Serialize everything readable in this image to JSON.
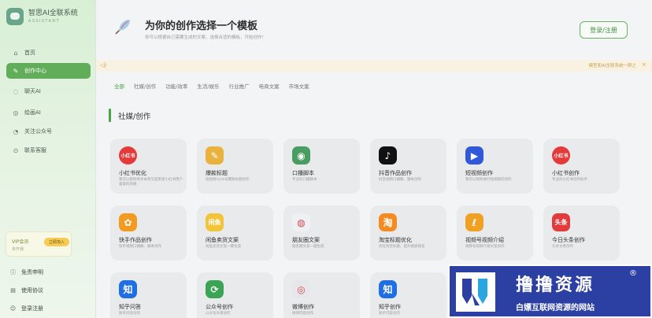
{
  "brand": {
    "name": "智思AI全联系统",
    "sub": "ASSISTANT"
  },
  "nav": [
    {
      "label": "首页",
      "icon": "home-icon",
      "active": false
    },
    {
      "label": "创作中心",
      "icon": "edit-icon",
      "active": true
    },
    {
      "label": "聊天AI",
      "icon": "chat-icon",
      "active": false
    },
    {
      "label": "绘画AI",
      "icon": "paint-icon",
      "active": false
    },
    {
      "label": "关注公众号",
      "icon": "wechat-icon",
      "active": false
    },
    {
      "label": "联系客服",
      "icon": "location-icon",
      "active": false
    }
  ],
  "vip": {
    "title": "VIP会员",
    "sub": "未开通",
    "button": "立即加入"
  },
  "bottom_links": [
    {
      "label": "免责申明",
      "icon": "info-icon"
    },
    {
      "label": "使用协议",
      "icon": "doc-icon"
    },
    {
      "label": "登录注册",
      "icon": "user-icon"
    }
  ],
  "header": {
    "title": "为你的创作选择一个模板",
    "subtitle": "你可以根据自己需要生成的文案，选择合适的模板，开始创作！",
    "login": "登录/注册"
  },
  "notice": {
    "text": "模型和AI全联系统一群之"
  },
  "tabs": [
    "全部",
    "社媒/创作",
    "功能/效率",
    "生活/娱乐",
    "行业推广",
    "电商文案",
    "市场文案"
  ],
  "section_title": "社媒/创作",
  "cards": [
    {
      "title": "小红书优化",
      "desc": "我可以帮你将文本改写成更受小红书用户喜爱的风格",
      "icon": "xiaohongshu-icon",
      "color": "#e53a3a",
      "glyph": "小红书"
    },
    {
      "title": "爆款标题",
      "desc": "短视频/公众号爆款标题创作",
      "icon": "pen-icon",
      "color": "#e8b23c",
      "glyph": "✎"
    },
    {
      "title": "口播脚本",
      "desc": "专业的口播脚本",
      "icon": "voice-icon",
      "color": "#4a9d62",
      "glyph": "◉"
    },
    {
      "title": "抖音作品创作",
      "desc": "抖音视频口播稿、脚本创作",
      "icon": "douyin-icon",
      "color": "#111111",
      "glyph": "♪"
    },
    {
      "title": "短视频创作",
      "desc": "我可以帮你进行短视频的创作",
      "icon": "video-icon",
      "color": "#2f59d9",
      "glyph": "▶"
    },
    {
      "title": "小红书创作",
      "desc": "专业的小红书创作助手",
      "icon": "xiaohongshu-icon",
      "color": "#e53a3a",
      "glyph": "小红书"
    },
    {
      "title": "快手作品创作",
      "desc": "快手视频口播稿、脚本创作",
      "icon": "kuaishou-icon",
      "color": "#f39a22",
      "glyph": "✿"
    },
    {
      "title": "闲鱼卖货文案",
      "desc": "闲鱼卖货文案一键生成",
      "icon": "xianyu-icon",
      "color": "#f2c437",
      "glyph": "闲鱼"
    },
    {
      "title": "朋友圈文案",
      "desc": "朋友圈文案一键生成",
      "icon": "moments-icon",
      "color": "#eef0f3",
      "glyph": "◍"
    },
    {
      "title": "淘宝标题优化",
      "desc": "优化淘宝标题，提升搜索排名",
      "icon": "taobao-icon",
      "color": "#f58a22",
      "glyph": "淘"
    },
    {
      "title": "视频号视频介绍",
      "desc": "视频号视频介绍文案创作",
      "icon": "channels-icon",
      "color": "#f0a022",
      "glyph": "ℓ"
    },
    {
      "title": "今日头条创作",
      "desc": "头条文章创作",
      "icon": "toutiao-icon",
      "color": "#e33b3b",
      "glyph": "头条"
    },
    {
      "title": "知乎问答",
      "desc": "知乎问答创作",
      "icon": "zhihu-icon",
      "color": "#1f6fe3",
      "glyph": "知"
    },
    {
      "title": "公众号创作",
      "desc": "公众号文章创作",
      "icon": "refresh-icon",
      "color": "#3aa655",
      "glyph": "⟳"
    },
    {
      "title": "微博创作",
      "desc": "微博内容创作",
      "icon": "weibo-icon",
      "color": "#e6e7ea",
      "glyph": "◎"
    },
    {
      "title": "知乎创作",
      "desc": "知乎内容创作",
      "icon": "zhihu-icon",
      "color": "#1f6fe3",
      "glyph": "知"
    }
  ],
  "watermark": {
    "main": "撸撸资源",
    "reg": "®",
    "sub": "白嫖互联网资源的网站"
  }
}
